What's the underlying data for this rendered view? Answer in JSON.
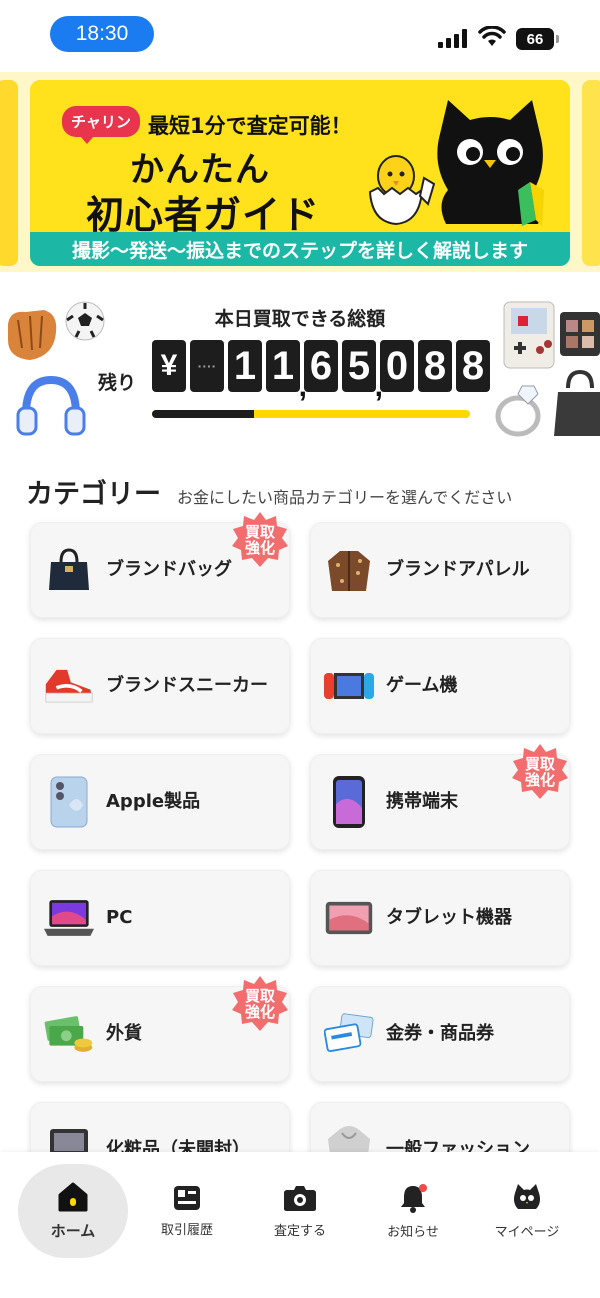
{
  "status_bar": {
    "time": "18:30",
    "battery": "66"
  },
  "banner": {
    "chip": "チャリン",
    "subtitle": "最短1分で査定可能！",
    "title_line1": "かんたん",
    "title_line2": "初心者ガイド",
    "footer": "撮影〜発送〜振込までのステップを詳しく解説します"
  },
  "total": {
    "label": "本日買取できる総額",
    "remaining_label": "残り",
    "currency": "¥",
    "digits": [
      "1",
      "1",
      "6",
      "5",
      "0",
      "8",
      "8"
    ],
    "amount": "1,165,088",
    "progress_fraction": 0.32
  },
  "categories": {
    "title": "カテゴリー",
    "subtitle": "お金にしたい商品カテゴリーを選んでください",
    "badge_text": "買取\n強化",
    "items": [
      {
        "label": "ブランドバッグ",
        "icon": "handbag-icon",
        "badge": true
      },
      {
        "label": "ブランドアパレル",
        "icon": "jacket-icon",
        "badge": false
      },
      {
        "label": "ブランドスニーカー",
        "icon": "sneaker-icon",
        "badge": false
      },
      {
        "label": "ゲーム機",
        "icon": "game-console-icon",
        "badge": false
      },
      {
        "label": "Apple製品",
        "icon": "iphone-icon",
        "badge": false
      },
      {
        "label": "携帯端末",
        "icon": "smartphone-icon",
        "badge": true
      },
      {
        "label": "PC",
        "icon": "laptop-icon",
        "badge": false
      },
      {
        "label": "タブレット機器",
        "icon": "tablet-icon",
        "badge": false
      },
      {
        "label": "外貨",
        "icon": "foreign-currency-icon",
        "badge": true
      },
      {
        "label": "金券・商品券",
        "icon": "gift-card-icon",
        "badge": false
      },
      {
        "label": "化粧品（未開封）",
        "icon": "cosmetics-icon",
        "badge": false
      },
      {
        "label": "一般ファッション",
        "icon": "hoodie-icon",
        "badge": false
      }
    ]
  },
  "nav": {
    "items": [
      {
        "label": "ホーム",
        "icon": "home-icon",
        "active": true
      },
      {
        "label": "取引履歴",
        "icon": "history-icon",
        "active": false
      },
      {
        "label": "査定する",
        "icon": "camera-icon",
        "active": false
      },
      {
        "label": "お知らせ",
        "icon": "bell-icon",
        "active": false
      },
      {
        "label": "マイページ",
        "icon": "cat-face-icon",
        "active": false
      }
    ]
  },
  "colors": {
    "accent": "#ffe11c",
    "teal": "#1db8a5",
    "badge": "#f26d6d",
    "dark": "#1d1d1d"
  }
}
